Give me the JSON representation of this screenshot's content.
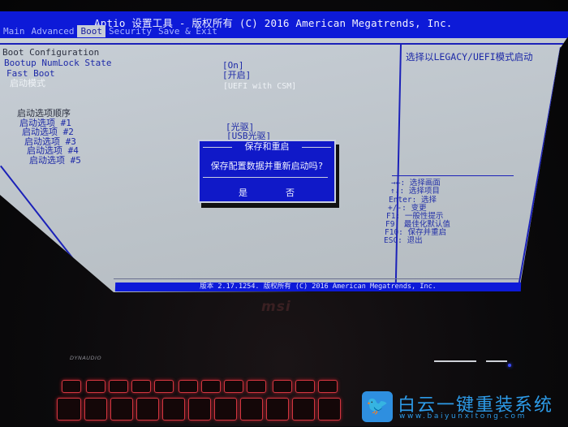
{
  "header": {
    "title": "Aptio 设置工具 - 版权所有 (C) 2016 American Megatrends, Inc.",
    "tabs": [
      {
        "label": "Main",
        "active": false
      },
      {
        "label": "Advanced",
        "active": false
      },
      {
        "label": "Boot",
        "active": true
      },
      {
        "label": "Security",
        "active": false
      },
      {
        "label": "Save & Exit",
        "active": false
      }
    ]
  },
  "boot": {
    "section_title": "Boot Configuration",
    "settings": [
      {
        "label": "Bootup NumLock State",
        "value": "[On]"
      },
      {
        "label": "Fast Boot",
        "value": "[开启]"
      },
      {
        "label": "启动模式",
        "value": "[UEFI with CSM]",
        "selected": true
      }
    ],
    "order_title": "启动选项顺序",
    "options": [
      {
        "label": "启动选项 #1",
        "value": "[光驱]"
      },
      {
        "label": "启动选项 #2",
        "value": "[USB光驱]"
      },
      {
        "label": "启动选项 #3",
        "value": ""
      },
      {
        "label": "启动选项 #4",
        "value": ""
      },
      {
        "label": "启动选项 #5",
        "value": ""
      }
    ]
  },
  "help_panel": {
    "description": "选择以LEGACY/UEFI模式启动",
    "keys": [
      "→←: 选择画面",
      "↑↓: 选择项目",
      "Enter: 选择",
      "+/-: 变更",
      "F1: 一般性提示",
      "F9: 最佳化默认值",
      "F10: 保存并重启",
      "ESC: 退出"
    ]
  },
  "dialog": {
    "title": "保存和重启",
    "message": "保存配置数据并重新启动吗?",
    "yes_label": "是",
    "no_label": "否"
  },
  "footer": {
    "text": "版本 2.17.1254. 版权所有 (C) 2016 American Megatrends, Inc."
  },
  "device": {
    "brand": "msi",
    "speaker_brand": "DYNAUDIO"
  },
  "watermark": {
    "icon": "twitter-bird-icon",
    "text": "白云一键重装系统",
    "url": "www.baiyunxitong.com"
  }
}
